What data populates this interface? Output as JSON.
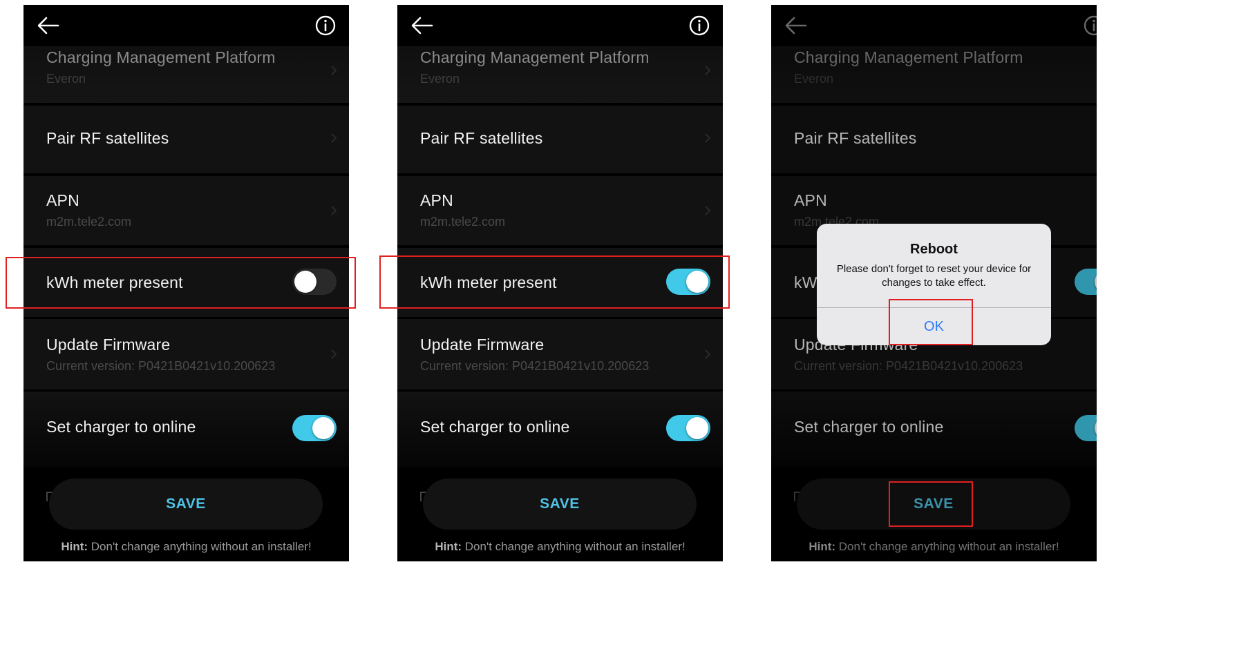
{
  "screens": [
    {
      "cmp_title": "Charging Management Platform",
      "cmp_value": "Everon",
      "pair_label": "Pair RF satellites",
      "apn_title": "APN",
      "apn_value": "m2m.tele2.com",
      "kwh_label": "kWh meter present",
      "kwh_state": "off",
      "fw_title": "Update Firmware",
      "fw_version": "Current version:  P0421B0421v10.200623",
      "online_label": "Set charger to online",
      "online_state": "on",
      "save_label": "SAVE",
      "hint_bold": "Hint:",
      "hint_text": " Don't change anything without an installer!"
    },
    {
      "cmp_title": "Charging Management Platform",
      "cmp_value": "Everon",
      "pair_label": "Pair RF satellites",
      "apn_title": "APN",
      "apn_value": "m2m.tele2.com",
      "kwh_label": "kWh meter present",
      "kwh_state": "on",
      "fw_title": "Update Firmware",
      "fw_version": "Current version:  P0421B0421v10.200623",
      "online_label": "Set charger to online",
      "online_state": "on",
      "save_label": "SAVE",
      "hint_bold": "Hint:",
      "hint_text": " Don't change anything without an installer!"
    },
    {
      "cmp_title": "Charging Management Platform",
      "cmp_value": "Everon",
      "pair_label": "Pair RF satellites",
      "apn_title": "APN",
      "apn_value": "m2m.tele2.com",
      "kwh_label": "kWh meter present",
      "kwh_state": "on",
      "fw_title": "Update Firmware",
      "fw_version": "Current version:  P0421B0421v10.200623",
      "online_label": "Set charger to online",
      "online_state": "on",
      "save_label": "SAVE",
      "hint_bold": "Hint:",
      "hint_text": " Don't change anything without an installer!",
      "dialog": {
        "title": "Reboot",
        "message": "Please don't forget to reset your device for changes to take effect.",
        "ok_label": "OK"
      }
    }
  ],
  "colors": {
    "accent": "#41c9e9",
    "save_text": "#4fc3e5",
    "highlight": "#e02020",
    "dialog_button": "#2f7bf5"
  },
  "icons": [
    "back-arrow-icon",
    "info-icon",
    "chevron-right-icon"
  ]
}
